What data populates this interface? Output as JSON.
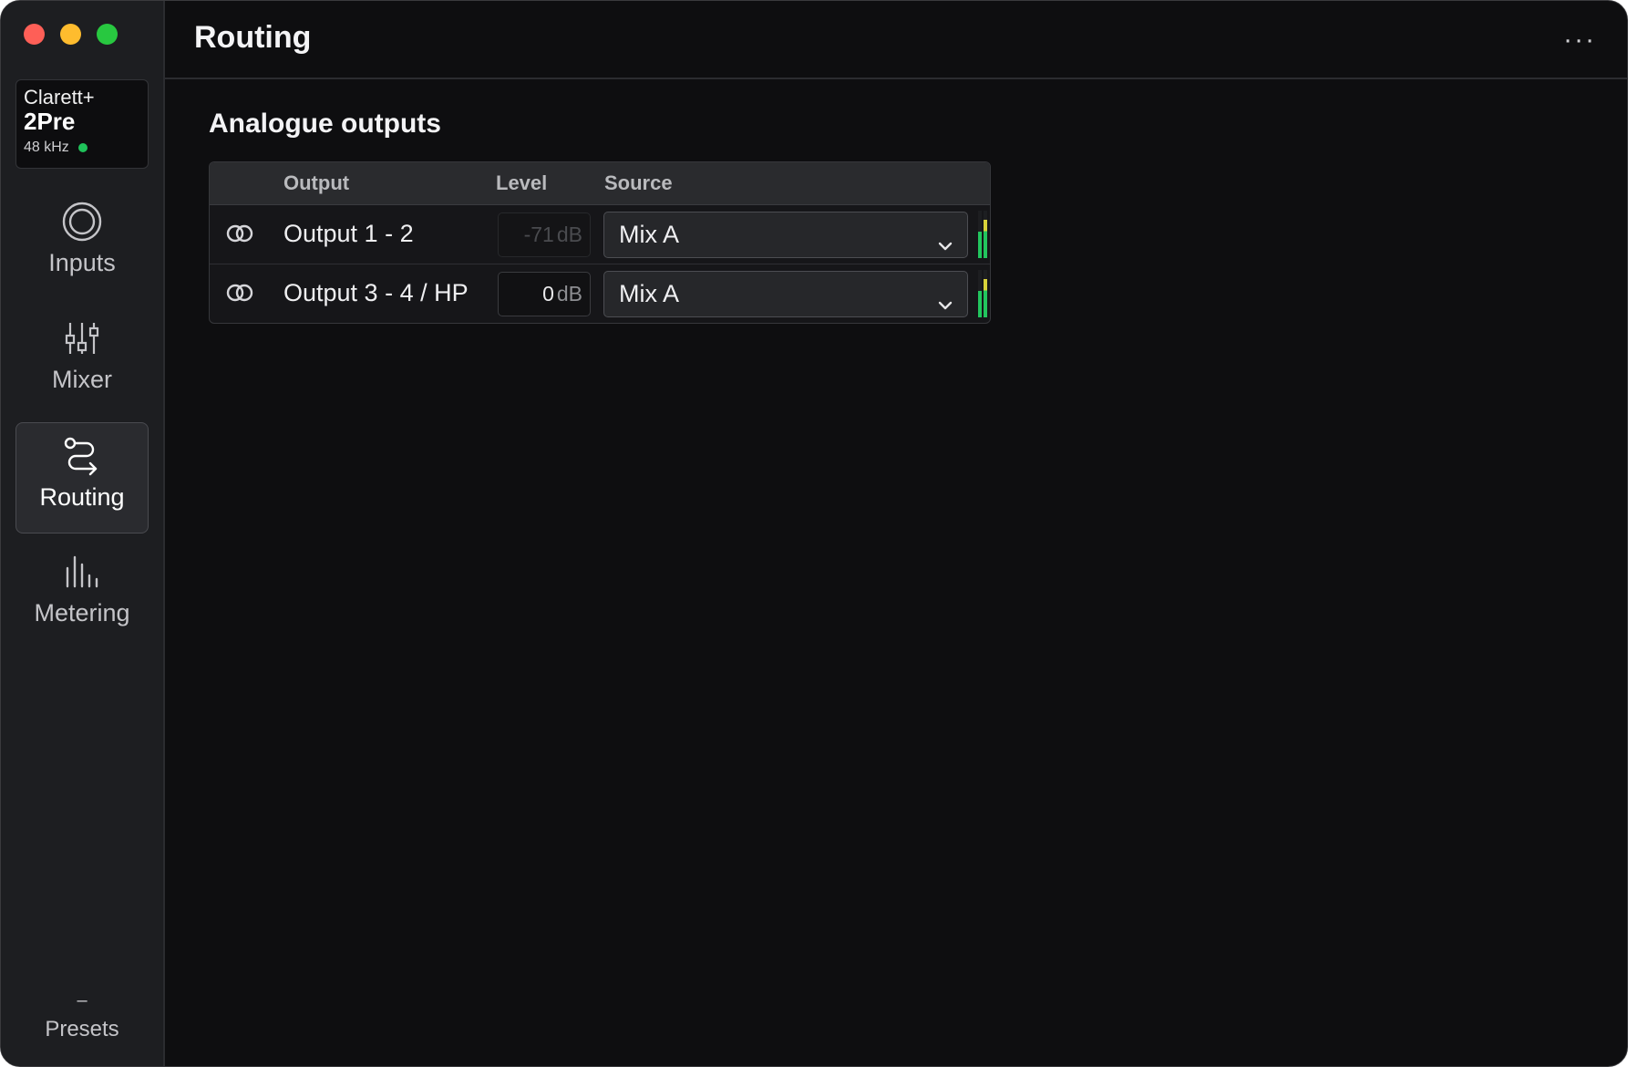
{
  "window": {
    "controls": [
      "close",
      "minimize",
      "zoom"
    ]
  },
  "device": {
    "brand": "Clarett+",
    "model": "2Pre",
    "sample_rate": "48 kHz",
    "status_color": "#1fc25a"
  },
  "sidebar": {
    "items": [
      {
        "label": "Inputs",
        "icon": "inputs-rings-icon",
        "active": false
      },
      {
        "label": "Mixer",
        "icon": "mixer-sliders-icon",
        "active": false
      },
      {
        "label": "Routing",
        "icon": "routing-path-icon",
        "active": true
      },
      {
        "label": "Metering",
        "icon": "metering-bars-icon",
        "active": false
      }
    ],
    "presets": {
      "dash": "–",
      "label": "Presets"
    }
  },
  "header": {
    "title": "Routing",
    "more": "···"
  },
  "analogue_outputs": {
    "title": "Analogue outputs",
    "columns": {
      "output": "Output",
      "level": "Level",
      "source": "Source"
    },
    "rows": [
      {
        "name": "Output 1 - 2",
        "level_value": "-71",
        "level_unit": "dB",
        "level_enabled": false,
        "source": "Mix A",
        "meter": [
          0.55,
          0.8
        ]
      },
      {
        "name": "Output 3 - 4 / HP",
        "level_value": "0",
        "level_unit": "dB",
        "level_enabled": true,
        "source": "Mix A",
        "meter": [
          0.55,
          0.8
        ]
      }
    ]
  },
  "colors": {
    "accent_green": "#22c55e",
    "meter_peak": "#d8d23a"
  }
}
